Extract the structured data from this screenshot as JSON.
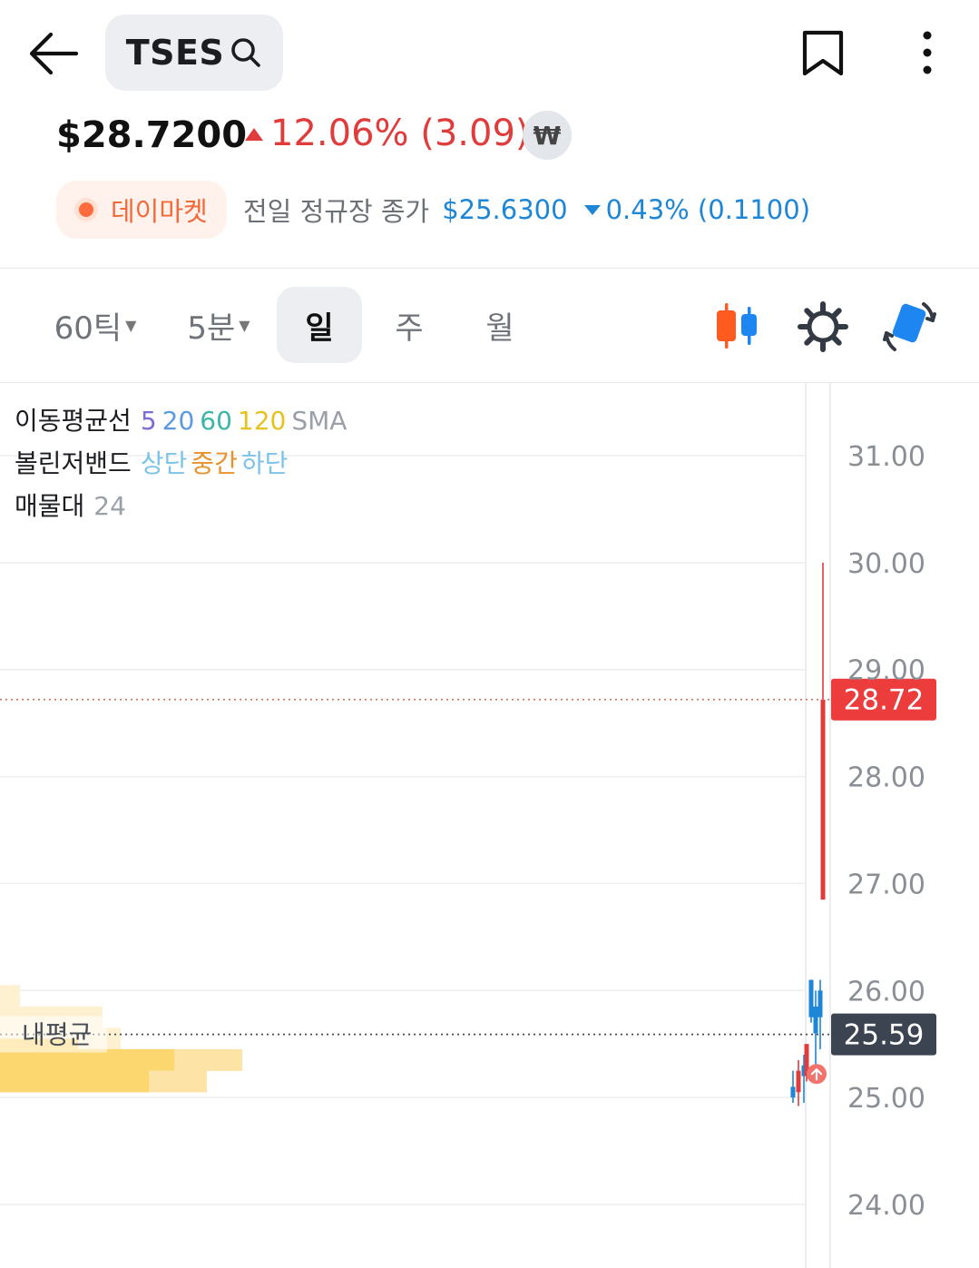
{
  "header": {
    "ticker": "TSES",
    "back_icon": "arrow-left-icon",
    "search_icon": "search-icon",
    "bookmark_icon": "bookmark-icon",
    "more_icon": "more-vertical-icon"
  },
  "quote": {
    "price": "$28.7200",
    "change_text": "12.06% (3.09)",
    "change_direction": "up",
    "currency_button": "₩",
    "up_color": "#e03c3c",
    "down_color": "#1e86d6"
  },
  "day_market": {
    "label": "데이마켓",
    "prev_close_label": "전일 정규장 종가",
    "prev_close_price": "$25.6300",
    "prev_change_text": "0.43% (0.1100)",
    "prev_change_direction": "down"
  },
  "tabs": [
    {
      "label": "60틱",
      "dropdown": true,
      "active": false
    },
    {
      "label": "5분",
      "dropdown": true,
      "active": false
    },
    {
      "label": "일",
      "dropdown": false,
      "active": true
    },
    {
      "label": "주",
      "dropdown": false,
      "active": false
    },
    {
      "label": "월",
      "dropdown": false,
      "active": false
    }
  ],
  "toolbar_icons": [
    "candlestick-icon",
    "gear-icon",
    "rotate-icon"
  ],
  "indicators": {
    "ma_label": "이동평균선",
    "ma_periods": [
      {
        "text": "5",
        "color": "#7b6cd6"
      },
      {
        "text": "20",
        "color": "#5a9be0"
      },
      {
        "text": "60",
        "color": "#3bb6a6"
      },
      {
        "text": "120",
        "color": "#e7c21e"
      },
      {
        "text": "SMA",
        "color": "#9aa0a8"
      }
    ],
    "bb_label": "볼린저밴드",
    "bb_parts": [
      {
        "text": "상단",
        "color": "#7cc3e8"
      },
      {
        "text": "중간",
        "color": "#e8922c"
      },
      {
        "text": "하단",
        "color": "#7cc3e8"
      }
    ],
    "vp_label": "매물대",
    "vp_value": "24"
  },
  "chart_data": {
    "type": "candlestick",
    "y_ticks": [
      "31.00",
      "30.00",
      "29.00",
      "28.00",
      "27.00",
      "26.00",
      "25.00",
      "24.00"
    ],
    "ylim": [
      23.6,
      31.7
    ],
    "current_price_label": "28.72",
    "current_price": 28.72,
    "avg_price_label": "25.59",
    "avg_price": 25.59,
    "avg_line_label": "내평균",
    "grid": true,
    "candles": [
      {
        "open": 25.05,
        "close": 25.25,
        "high": 25.35,
        "low": 24.92,
        "color": "up"
      },
      {
        "open": 25.1,
        "close": 25.0,
        "high": 25.25,
        "low": 24.95,
        "color": "down"
      },
      {
        "open": 25.3,
        "close": 25.2,
        "high": 25.4,
        "low": 24.95,
        "color": "down"
      },
      {
        "open": 25.2,
        "close": 25.5,
        "high": 25.5,
        "low": 25.15,
        "color": "up"
      },
      {
        "open": 26.1,
        "close": 25.75,
        "high": 26.1,
        "low": 25.7,
        "color": "down"
      },
      {
        "open": 25.85,
        "close": 25.6,
        "high": 26.0,
        "low": 25.2,
        "color": "down"
      },
      {
        "open": 26.0,
        "close": 25.75,
        "high": 26.1,
        "low": 25.45,
        "color": "down"
      },
      {
        "open": 26.85,
        "close": 28.72,
        "high": 30.0,
        "low": 26.85,
        "color": "up"
      }
    ],
    "volume_profile": [
      {
        "price": 25.95,
        "value": 22
      },
      {
        "price": 25.75,
        "value": 113
      },
      {
        "price": 25.55,
        "value": 133
      },
      {
        "price": 25.35,
        "value": 267
      },
      {
        "price": 25.15,
        "value": 228
      }
    ]
  }
}
